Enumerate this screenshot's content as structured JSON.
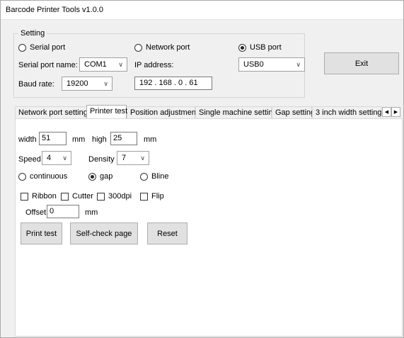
{
  "window": {
    "title": "Barcode Printer Tools v1.0.0"
  },
  "setting": {
    "legend": "Setting",
    "serial_port_label": "Serial port",
    "network_port_label": "Network port",
    "usb_port_label": "USB port",
    "selected_port": "USB port",
    "serial_port_name_label": "Serial port name:",
    "serial_port_name_value": "COM1",
    "ip_address_label": "IP address:",
    "ip_address_value": "192 . 168 .  0  .  61",
    "usb_value": "USB0",
    "baud_rate_label": "Baud rate:",
    "baud_rate_value": "19200",
    "exit_label": "Exit"
  },
  "tabs": [
    {
      "label": "Network port settings",
      "active": false
    },
    {
      "label": "Printer test",
      "active": true
    },
    {
      "label": "Position adjustment",
      "active": false
    },
    {
      "label": "Single machine setting",
      "active": false
    },
    {
      "label": "Gap setting",
      "active": false
    },
    {
      "label": "3 inch width setting",
      "active": false
    }
  ],
  "printer_test": {
    "width_label": "width",
    "width_value": "51",
    "width_unit": "mm",
    "high_label": "high",
    "high_value": "25",
    "high_unit": "mm",
    "speed_label": "Speed",
    "speed_value": "4",
    "density_label": "Density",
    "density_value": "7",
    "continuous_label": "continuous",
    "gap_label": "gap",
    "bline_label": "Bline",
    "selected_mode": "gap",
    "ribbon_label": "Ribbon",
    "cutter_label": "Cutter",
    "dpi300_label": "300dpi",
    "flip_label": "Flip",
    "offset_label": "Offset",
    "offset_value": "0",
    "offset_unit": "mm",
    "print_test_label": "Print test",
    "self_check_label": "Self-check page",
    "reset_label": "Reset"
  },
  "icons": {
    "dropdown": "chevron-down-icon",
    "scroll_left": "scroll-left-icon",
    "scroll_right": "scroll-right-icon"
  }
}
